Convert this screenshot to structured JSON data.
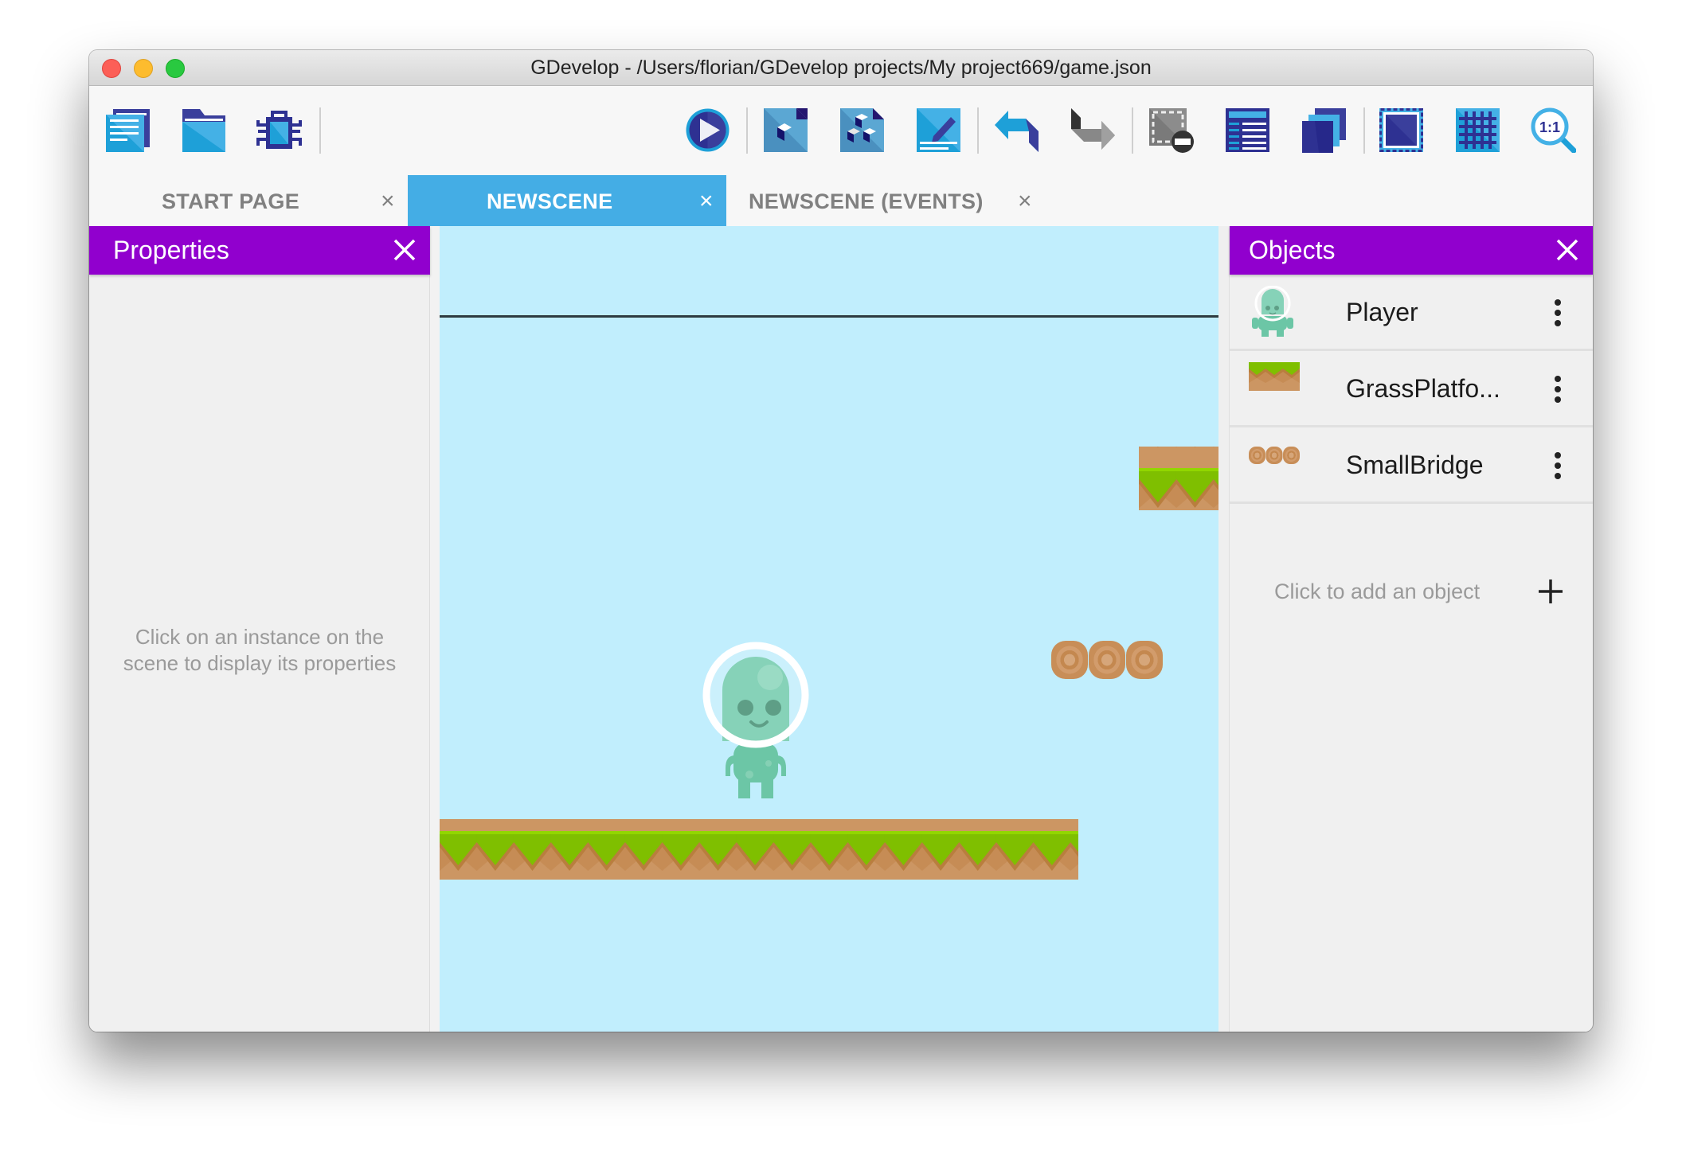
{
  "window": {
    "title": "GDevelop - /Users/florian/GDevelop projects/My project669/game.json",
    "traffic_lights": [
      "close",
      "minimize",
      "maximize"
    ]
  },
  "toolbar": {
    "left_tools": [
      {
        "name": "project-manager-icon",
        "tooltip": "Project manager"
      },
      {
        "name": "open-folder-icon",
        "tooltip": "Open project"
      },
      {
        "name": "debugger-bug-icon",
        "tooltip": "Debugger"
      }
    ],
    "right_tools": [
      {
        "name": "preview-play-icon"
      },
      {
        "name": "objects-list-icon"
      },
      {
        "name": "object-groups-icon"
      },
      {
        "name": "edit-properties-icon"
      },
      {
        "name": "undo-icon"
      },
      {
        "name": "redo-icon"
      },
      {
        "name": "delete-selection-icon"
      },
      {
        "name": "instances-list-icon"
      },
      {
        "name": "layers-icon"
      },
      {
        "name": "window-mask-icon"
      },
      {
        "name": "grid-icon"
      },
      {
        "name": "zoom-reset-icon",
        "label": "1:1"
      }
    ]
  },
  "tabs": [
    {
      "label": "START PAGE",
      "active": false
    },
    {
      "label": "NEWSCENE",
      "active": true
    },
    {
      "label": "NEWSCENE (EVENTS)",
      "active": false
    }
  ],
  "tab_close_glyph": "×",
  "properties_panel": {
    "title": "Properties",
    "empty_line1": "Click on an instance on the",
    "empty_line2": "scene to display its properties"
  },
  "objects_panel": {
    "title": "Objects",
    "items": [
      {
        "name": "Player",
        "type": "sprite-player"
      },
      {
        "name": "GrassPlatfo...",
        "type": "grass-platform"
      },
      {
        "name": "SmallBridge",
        "type": "small-bridge"
      }
    ],
    "add_label": "Click to add an object"
  },
  "scene": {
    "background_color": "#c1eefd",
    "instances": [
      {
        "object": "Player"
      },
      {
        "object": "GrassPlatform"
      },
      {
        "object": "GrassPlatform"
      },
      {
        "object": "SmallBridge"
      }
    ]
  },
  "colors": {
    "panel_header": "#9100ce",
    "active_tab": "#44ade5",
    "scene_bg": "#c1eefd",
    "grass": "#7fbf00",
    "dirt": "#c68c55"
  }
}
